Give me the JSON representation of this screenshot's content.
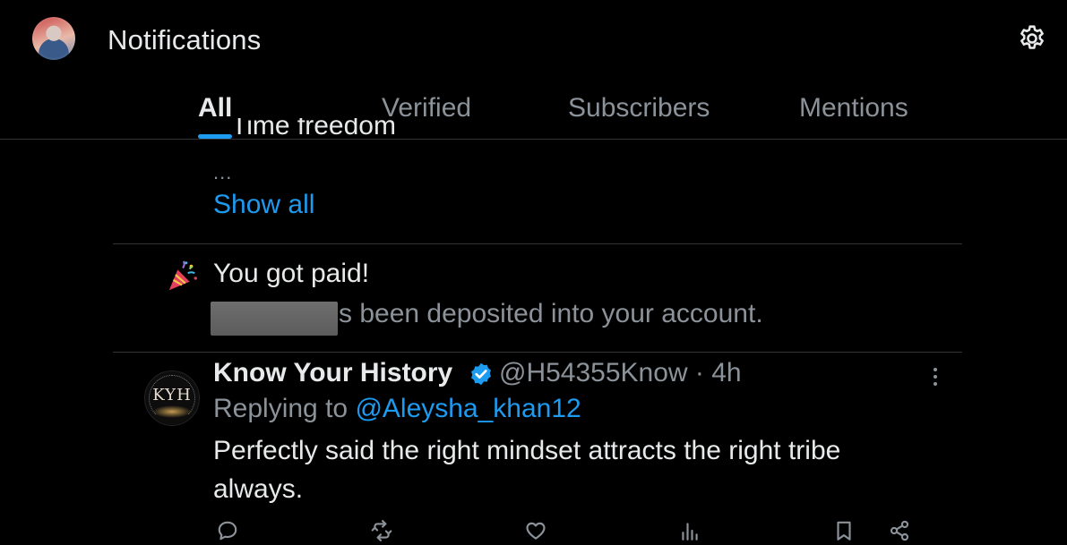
{
  "header": {
    "title": "Notifications"
  },
  "tabs": [
    {
      "label": "All",
      "active": true
    },
    {
      "label": "Verified",
      "active": false
    },
    {
      "label": "Subscribers",
      "active": false
    },
    {
      "label": "Mentions",
      "active": false
    }
  ],
  "previous_item": {
    "clipped_text": "Time freedom",
    "ellipsis": "...",
    "show_all_label": "Show all"
  },
  "paid_notification": {
    "icon": "party-popper-icon",
    "title": "You got paid!",
    "body_visible": "s been deposited into your account."
  },
  "tweet": {
    "author_name": "Know Your History",
    "verified": true,
    "handle_time": "@H54355Know · 4h",
    "replying_prefix": "Replying to ",
    "replying_to": "@Aleysha_khan12",
    "text": "Perfectly said the right mindset attracts the right tribe always.",
    "avatar_text": "KYH"
  },
  "actions": [
    "reply-icon",
    "retweet-icon",
    "like-icon",
    "views-icon",
    "bookmark-icon",
    "share-icon"
  ],
  "colors": {
    "background": "#000000",
    "text_primary": "#e7e9ea",
    "text_secondary": "#8b9299",
    "accent": "#1d9bf0",
    "divider": "#2f3336"
  }
}
